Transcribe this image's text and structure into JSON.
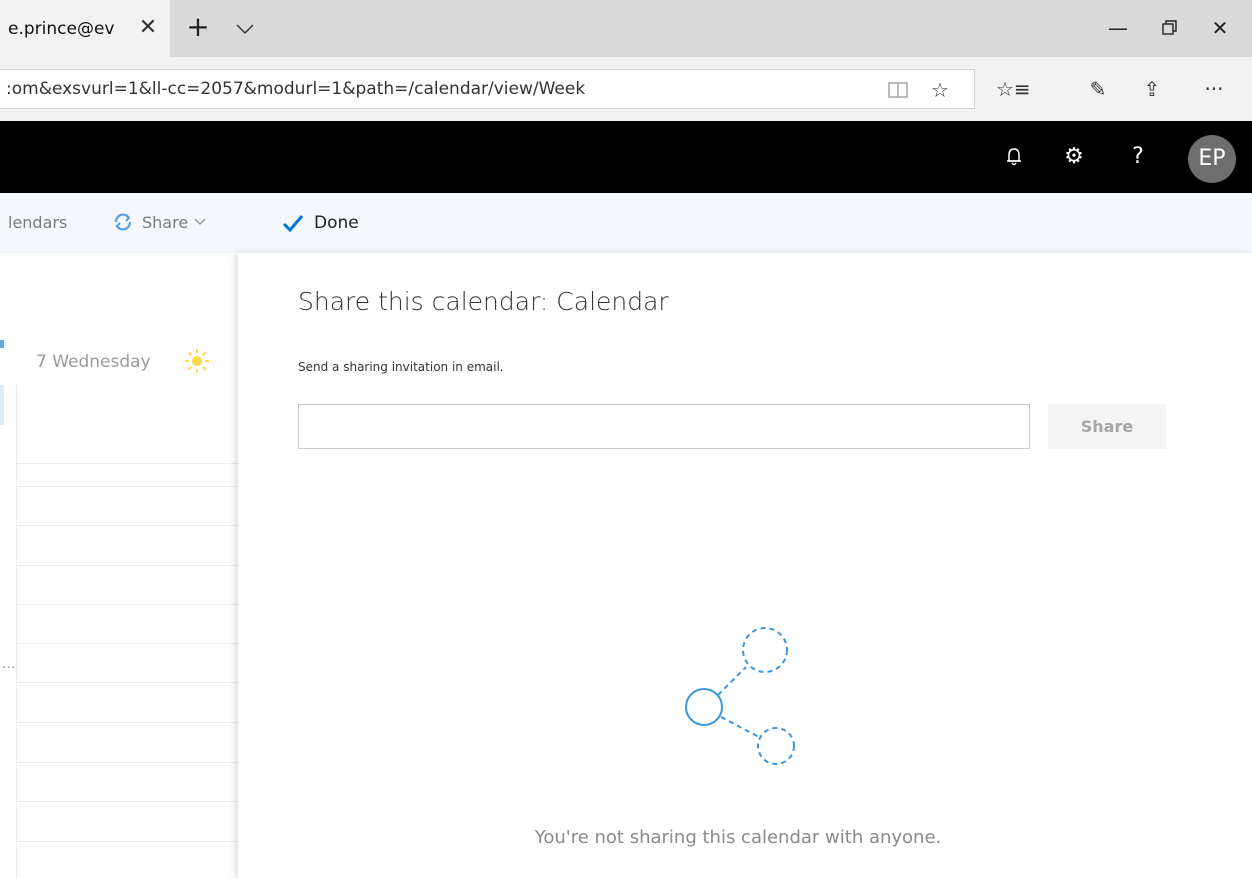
{
  "browser": {
    "tab_title": "e.prince@ev",
    "tab_close": "✕",
    "new_tab": "+",
    "tab_list": "⌵",
    "minimize": "—",
    "restore": "⧉",
    "close": "✕",
    "url": ":om&exsvurl=1&ll-cc=2057&modurl=1&path=/calendar/view/Week",
    "reading_view": "📖",
    "favorite": "☆",
    "favorites_list": "☆≡",
    "notes": "✎",
    "share": "⇪",
    "more": "···"
  },
  "header": {
    "notifications": "🔔",
    "settings": "⚙",
    "help": "?",
    "avatar_initials": "EP"
  },
  "commandbar": {
    "calendars_label": "lendars",
    "share_label": "Share",
    "share_chevron": "⌄",
    "done_label": "Done"
  },
  "calendar": {
    "day_label": "7 Wednesday",
    "ellipsis": "..."
  },
  "share_panel": {
    "title": "Share this calendar: Calendar",
    "subtitle": "Send a sharing invitation in email.",
    "email_placeholder": "",
    "email_value": "",
    "share_button": "Share",
    "empty_message": "You're not sharing this calendar with anyone."
  },
  "colors": {
    "accent": "#0078d7",
    "header_bg": "#000000",
    "command_bg": "#f4f7fb"
  }
}
